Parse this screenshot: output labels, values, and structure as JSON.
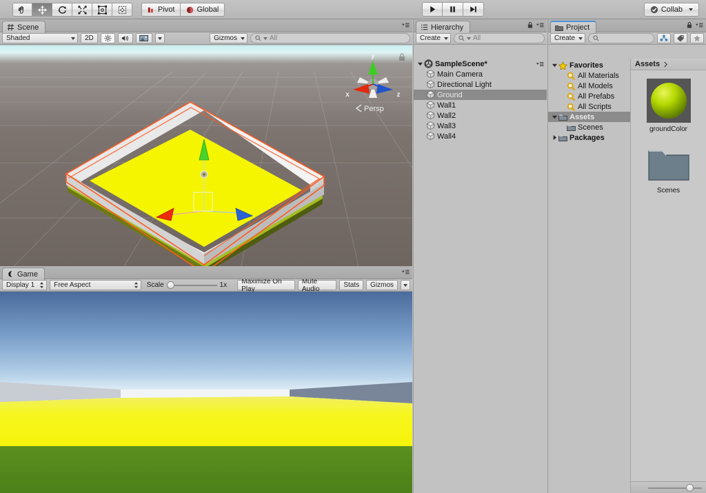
{
  "toolbar": {
    "transform_tools": [
      {
        "name": "hand-tool",
        "label": "Hand",
        "active": false
      },
      {
        "name": "move-tool",
        "label": "Move",
        "active": true
      },
      {
        "name": "rotate-tool",
        "label": "Rotate",
        "active": false
      },
      {
        "name": "scale-tool",
        "label": "Scale",
        "active": false
      },
      {
        "name": "rect-tool",
        "label": "Rect",
        "active": false
      },
      {
        "name": "transform-tool",
        "label": "Transform",
        "active": false
      }
    ],
    "pivot_label": "Pivot",
    "global_label": "Global",
    "play_label": "Play",
    "pause_label": "Pause",
    "step_label": "Step",
    "collab_label": "Collab"
  },
  "scene": {
    "tab_label": "Scene",
    "draw_mode": "Shaded",
    "mode_2d": "2D",
    "gizmos_label": "Gizmos",
    "search_placeholder": "All",
    "gizmo": {
      "x_label": "x",
      "y_label": "y",
      "z_label": "z",
      "projection": "Persp"
    }
  },
  "game": {
    "tab_label": "Game",
    "display": "Display 1",
    "aspect": "Free Aspect",
    "scale_label": "Scale",
    "scale_value": "1x",
    "maximize_label": "Maximize On Play",
    "mute_label": "Mute Audio",
    "stats_label": "Stats",
    "gizmos_label": "Gizmos"
  },
  "hierarchy": {
    "tab_label": "Hierarchy",
    "create_label": "Create",
    "search_placeholder": "All",
    "scene_name": "SampleScene*",
    "items": [
      {
        "label": "Main Camera",
        "selected": false
      },
      {
        "label": "Directional Light",
        "selected": false
      },
      {
        "label": "Ground",
        "selected": true
      },
      {
        "label": "Wall1",
        "selected": false
      },
      {
        "label": "Wall2",
        "selected": false
      },
      {
        "label": "Wall3",
        "selected": false
      },
      {
        "label": "Wall4",
        "selected": false
      }
    ]
  },
  "project": {
    "tab_label": "Project",
    "create_label": "Create",
    "search_placeholder": "",
    "tree": [
      {
        "label": "Favorites",
        "type": "favorites-root",
        "indent": 0,
        "bold": true,
        "expanded": true,
        "selected": false
      },
      {
        "label": "All Materials",
        "type": "search",
        "indent": 1,
        "bold": false,
        "expanded": false,
        "selected": false
      },
      {
        "label": "All Models",
        "type": "search",
        "indent": 1,
        "bold": false,
        "expanded": false,
        "selected": false
      },
      {
        "label": "All Prefabs",
        "type": "search",
        "indent": 1,
        "bold": false,
        "expanded": false,
        "selected": false
      },
      {
        "label": "All Scripts",
        "type": "search",
        "indent": 1,
        "bold": false,
        "expanded": false,
        "selected": false
      },
      {
        "label": "Assets",
        "type": "folder",
        "indent": 0,
        "bold": true,
        "expanded": true,
        "selected": true
      },
      {
        "label": "Scenes",
        "type": "folder",
        "indent": 1,
        "bold": false,
        "expanded": false,
        "selected": false
      },
      {
        "label": "Packages",
        "type": "folder",
        "indent": 0,
        "bold": true,
        "expanded": false,
        "selected": false
      }
    ],
    "breadcrumb": "Assets",
    "assets": [
      {
        "label": "groundColor",
        "type": "material",
        "color": "#b5d900"
      },
      {
        "label": "Scenes",
        "type": "folder",
        "color": "#6d7f8a"
      }
    ]
  },
  "colors": {
    "chrome": "#c2c2c2",
    "selection": "#8b8b8b",
    "tab_accent": "#4c90d9",
    "ground_yellow": "#f5f50a",
    "gizmo_x": "#e8290b",
    "gizmo_y": "#4ad42a",
    "gizmo_z": "#1d59d6",
    "outline_orange": "#ff5a1f"
  }
}
